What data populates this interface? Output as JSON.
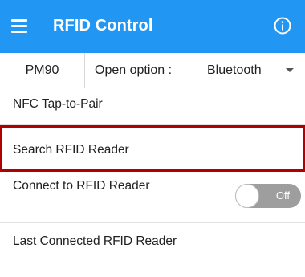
{
  "appbar": {
    "title": "RFID Control",
    "menu_icon": "hamburger-menu-icon",
    "info_icon": "info-icon",
    "background_color": "#2196f3"
  },
  "option_bar": {
    "device": "PM90",
    "open_option_label": "Open option :",
    "transport_selected": "Bluetooth",
    "dropdown_icon": "dropdown-arrow-icon"
  },
  "list": {
    "nfc_tap_to_pair": "NFC Tap-to-Pair",
    "search_reader": "Search RFID Reader",
    "connect_reader": "Connect to RFID Reader",
    "last_connected_reader": "Last Connected RFID Reader"
  },
  "connect_toggle": {
    "state_label": "Off",
    "on": false,
    "off_color": "#9e9e9e"
  },
  "highlight_color": "#b00000"
}
